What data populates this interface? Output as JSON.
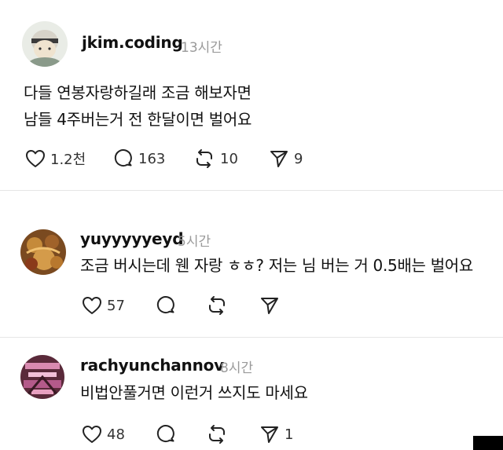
{
  "main_post": {
    "username": "jkim.coding",
    "time": "13시간",
    "lines": [
      "다들 연봉자랑하길래 조금 해보자면",
      "남들 4주버는거 전 한달이면 벌어요"
    ],
    "likes": "1.2천",
    "replies": "163",
    "reposts": "10",
    "shares": "9"
  },
  "reply1": {
    "username": "yuyyyyyeyd",
    "time": "5시간",
    "text": "조금 버시는데 웬 자랑 ㅎㅎ? 저는 님 버는 거 0.5배는 벌어요",
    "likes": "57"
  },
  "reply2": {
    "username": "rachyunchannov",
    "time": "8시간",
    "text": "비법안풀거면 이런거 쓰지도 마세요",
    "likes": "48",
    "shares": "1"
  },
  "icons": {
    "like": "heart-icon",
    "reply": "speech-bubble-icon",
    "repost": "repost-icon",
    "share": "send-icon"
  },
  "colors": {
    "text": "#111111",
    "muted": "#9a9a9a",
    "icon": "#222222",
    "divider": "#e6e6e6"
  }
}
